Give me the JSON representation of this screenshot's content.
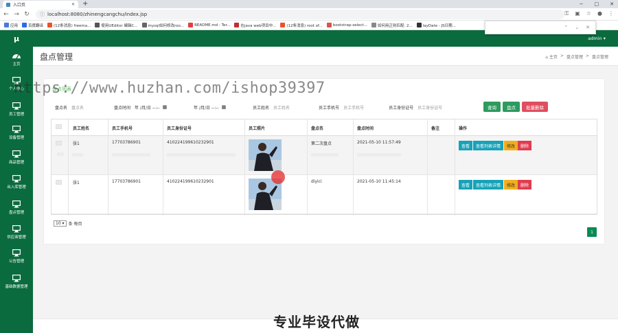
{
  "browser": {
    "tab_title": "入口页",
    "url": "localhost:8080/zhinengcangchu/index.jsp",
    "bookmarks": [
      {
        "label": "应用",
        "color": "#4a7bd4"
      },
      {
        "label": "百度翻译",
        "color": "#2b6de0"
      },
      {
        "label": "(12条消息) freema...",
        "color": "#e8542a"
      },
      {
        "label": "使用UEditor 编辑C...",
        "color": "#555555"
      },
      {
        "label": "mysql如何修改roo...",
        "color": "#666666"
      },
      {
        "label": "README.md - Ter...",
        "color": "#e04040"
      },
      {
        "label": "在java web项目中...",
        "color": "#c03030"
      },
      {
        "label": "(12条消息) root of...",
        "color": "#e8542a"
      },
      {
        "label": "bootstrap-select...",
        "color": "#d9534f"
      },
      {
        "label": "如何用正则匹配: 2...",
        "color": "#888888"
      },
      {
        "label": "layDate - JS日期...",
        "color": "#333333"
      }
    ],
    "window_controls": [
      "−",
      "□",
      "✕"
    ]
  },
  "app": {
    "logo": "μ",
    "user": "admin ▾",
    "sidebar": [
      {
        "label": "主页",
        "icon": "dashboard-icon"
      },
      {
        "label": "个人中心",
        "icon": "monitor-icon"
      },
      {
        "label": "员工管理",
        "icon": "monitor-icon"
      },
      {
        "label": "设备管理",
        "icon": "monitor-icon"
      },
      {
        "label": "商品管理",
        "icon": "monitor-icon"
      },
      {
        "label": "出入库管理",
        "icon": "monitor-icon"
      },
      {
        "label": "盘点管理",
        "icon": "monitor-icon"
      },
      {
        "label": "供应商管理",
        "icon": "monitor-icon"
      },
      {
        "label": "公告管理",
        "icon": "monitor-icon"
      },
      {
        "label": "基础数据管理",
        "icon": "monitor-icon"
      }
    ],
    "page_title": "盘点管理",
    "breadcrumb": [
      "⌂ 主页",
      ">",
      "盘点管理",
      ">",
      "盘点管理"
    ],
    "panel_title": "盘点列表",
    "search": {
      "name_label": "盘点名",
      "name_placeholder": "盘点名",
      "time_label": "盘点时间",
      "date_from": "年 /月/日 --:--",
      "date_to": "年 /月/日 --:--",
      "emp_name_label": "员工姓名",
      "emp_name_placeholder": "员工姓名",
      "emp_phone_label": "员工手机号",
      "emp_phone_placeholder": "员工手机号",
      "emp_id_label": "员工身份证号",
      "emp_id_placeholder": "员工身份证号",
      "btn_query": "查询",
      "btn_inventory": "盘点",
      "btn_batch_delete": "批量删除"
    },
    "table": {
      "headers": [
        "员工姓名",
        "员工手机号",
        "员工身份证号",
        "员工照片",
        "盘点名",
        "盘点时间",
        "备注",
        "操作"
      ],
      "rows": [
        {
          "name": "张1",
          "phone": "17703786901",
          "id_card": "410224199610232901",
          "inventory_name": "第二次盘点",
          "time": "2021-05-10 11:57:49",
          "note": ""
        },
        {
          "name": "张1",
          "phone": "17703786901",
          "id_card": "410224199610232901",
          "inventory_name": "diyici",
          "time": "2021-05-10 11:45:14",
          "note": ""
        }
      ],
      "row_actions": {
        "view": "查看",
        "view_detail": "查看列表详情",
        "edit": "修改",
        "delete": "删除"
      }
    },
    "pager": {
      "page_size": "10 ▾",
      "page_size_suffix": "条 每页",
      "current_page": "1"
    }
  },
  "overlay": {
    "watermark": "https://www.huzhan.com/ishop39397",
    "caption": "专业毕设代做"
  },
  "colors": {
    "primary_green": "#0a6b3e",
    "button_green": "#2d9a5e",
    "danger": "#e04f5f",
    "info": "#17a2b8",
    "warning": "#f0ad1e"
  }
}
